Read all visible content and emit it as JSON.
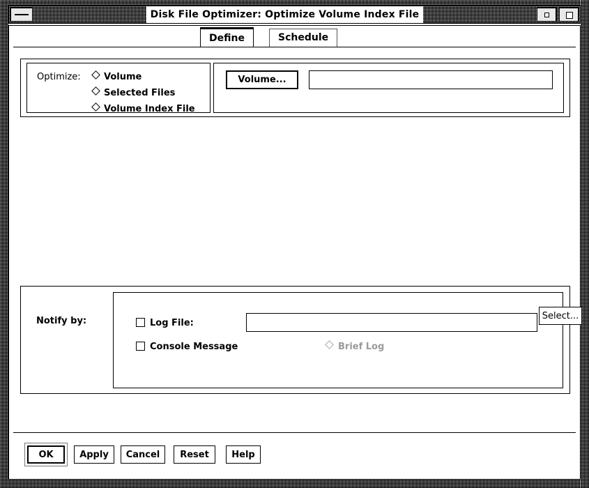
{
  "window": {
    "title": "Disk File Optimizer: Optimize Volume Index File",
    "menu_icon": "window-menu-icon",
    "minimize_icon": "minimize-icon",
    "maximize_icon": "maximize-icon"
  },
  "tabs": [
    {
      "id": "define",
      "label": "Define",
      "active": true
    },
    {
      "id": "schedule",
      "label": "Schedule",
      "active": false
    }
  ],
  "define_panel": {
    "optimize": {
      "label": "Optimize:",
      "options": [
        {
          "label": "Volume",
          "selected": false
        },
        {
          "label": "Selected Files",
          "selected": false
        },
        {
          "label": "Volume Index File",
          "selected": false
        }
      ],
      "volume_button": "Volume...",
      "volume_value": "",
      "volume_placeholder": ""
    },
    "notify": {
      "label": "Notify by:",
      "log_file": {
        "label": "Log File:",
        "checked": false,
        "value": "",
        "placeholder": "",
        "select_button": "Select..."
      },
      "console_message": {
        "label": "Console Message",
        "checked": false
      },
      "brief_log": {
        "label": "Brief Log",
        "selected": false,
        "enabled": false
      }
    }
  },
  "actions": [
    {
      "id": "ok",
      "label": "OK",
      "default": true
    },
    {
      "id": "apply",
      "label": "Apply",
      "default": false
    },
    {
      "id": "cancel",
      "label": "Cancel",
      "default": false
    },
    {
      "id": "reset",
      "label": "Reset",
      "default": false
    },
    {
      "id": "help",
      "label": "Help",
      "default": false
    }
  ],
  "colors": {
    "background": "#ffffff",
    "foreground": "#000000",
    "disabled": "#9a9a9a",
    "frame": "#808080"
  }
}
